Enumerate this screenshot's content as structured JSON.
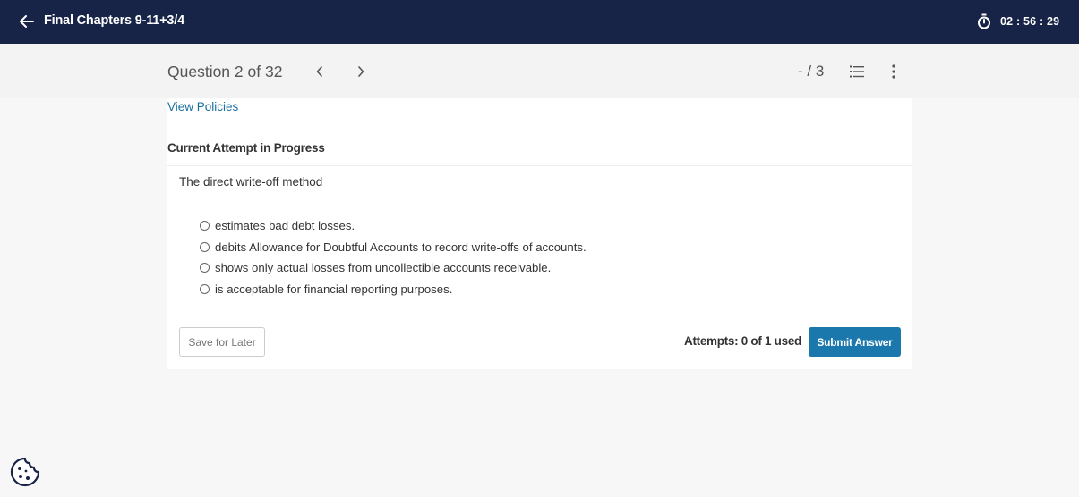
{
  "header": {
    "title": "Final Chapters 9-11+3/4",
    "timer": "02 : 56 : 29",
    "back_icon": "arrow-left-icon",
    "timer_icon": "stopwatch-icon"
  },
  "question_bar": {
    "label": "Question 2 of 32",
    "score": "- / 3",
    "prev_icon": "chevron-left-icon",
    "next_icon": "chevron-right-icon",
    "list_icon": "numbered-list-icon",
    "menu_icon": "kebab-menu-icon"
  },
  "card": {
    "view_policies": "View Policies",
    "attempt_title": "Current Attempt in Progress",
    "question": "The direct write-off method",
    "options": [
      "estimates bad debt losses.",
      "debits Allowance for Doubtful Accounts to record write-offs of accounts.",
      "shows only actual losses from uncollectible accounts receivable.",
      "is acceptable for financial reporting purposes."
    ],
    "save_label": "Save for Later",
    "attempts": "Attempts: 0 of 1 used",
    "submit_label": "Submit Answer"
  },
  "cookie_icon": "cookie-icon",
  "colors": {
    "header_bg": "#172347",
    "accent": "#1a78ad",
    "link": "#1a6f9f"
  }
}
